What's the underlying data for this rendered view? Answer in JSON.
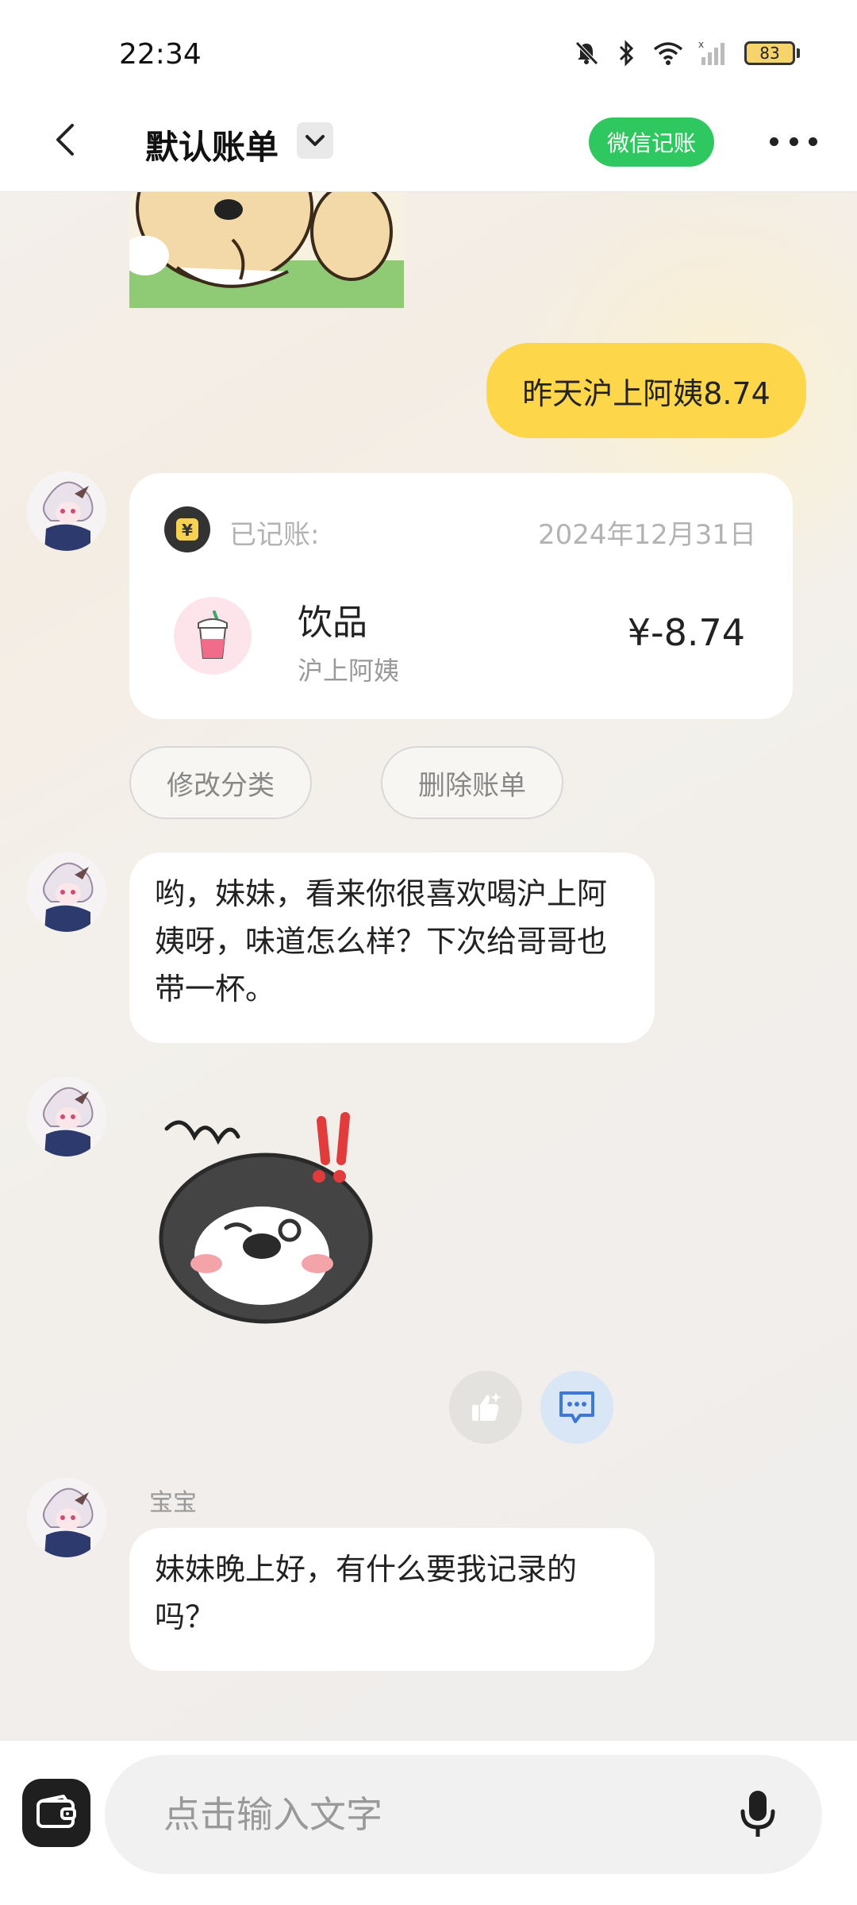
{
  "status_bar": {
    "time": "22:34",
    "battery": "83",
    "icons": [
      "mute-icon",
      "bluetooth-icon",
      "wifi-icon",
      "signal-icon",
      "battery-icon"
    ]
  },
  "header": {
    "title": "默认账单",
    "wechat_button": "微信记账",
    "icons": [
      "back-arrow-icon",
      "chevron-down-icon",
      "more-icon"
    ]
  },
  "messages": {
    "user_message": "昨天沪上阿姨8.74",
    "record_card": {
      "status": "已记账:",
      "date": "2024年12月31日",
      "category": "饮品",
      "merchant": "沪上阿姨",
      "amount": "¥-8.74"
    },
    "action_buttons": {
      "modify_category": "修改分类",
      "delete_bill": "删除账单"
    },
    "bot_reply": "哟，妹妹，看来你很喜欢喝沪上阿姨呀，味道怎么样？下次给哥哥也带一杯。",
    "sender_name": "宝宝",
    "bot_greeting": "妹妹晚上好，有什么要我记录的吗？"
  },
  "input_bar": {
    "placeholder": "点击输入文字",
    "icons": [
      "wallet-icon",
      "microphone-icon"
    ]
  },
  "colors": {
    "accent_yellow": "#fdd64a",
    "wechat_green": "#2fc75f",
    "reaction_blue": "#dbe8f7"
  }
}
